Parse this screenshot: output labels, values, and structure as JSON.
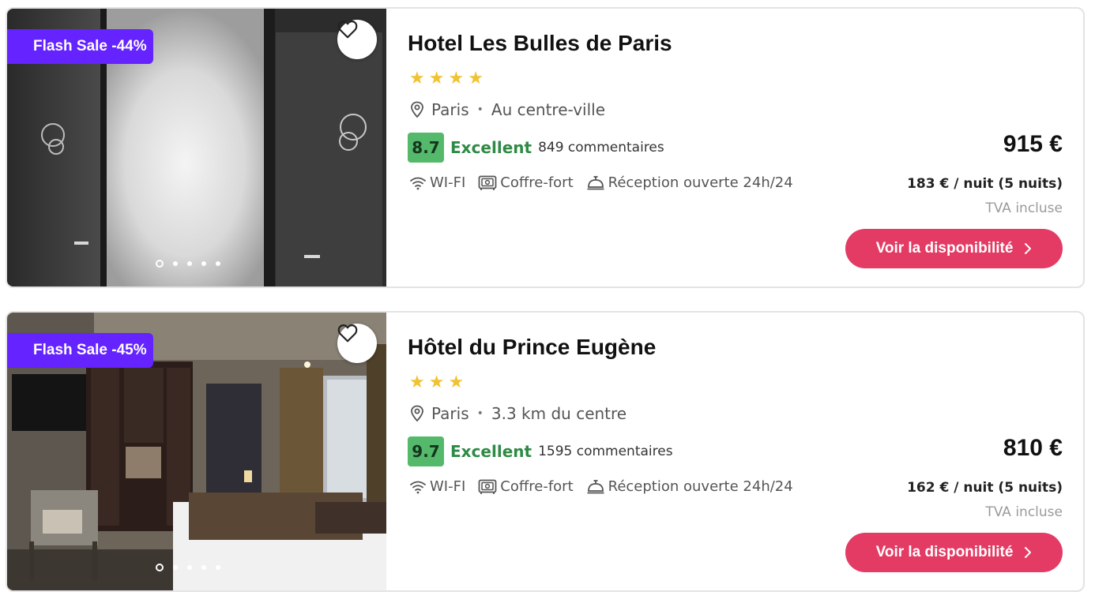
{
  "hotels": [
    {
      "badge": "Flash Sale -44%",
      "name": "Hotel Les Bulles de Paris",
      "stars": 4,
      "city": "Paris",
      "area": "Au centre-ville",
      "score": "8.7",
      "score_label": "Excellent",
      "reviews": "849 commentaires",
      "amenities": [
        "WI-FI",
        "Coffre-fort",
        "Réception ouverte 24h/24"
      ],
      "price": "915 €",
      "per_night": "183 € / nuit (5 nuits)",
      "vat": "TVA incluse",
      "cta": "Voir la disponibilité",
      "photo_dots": 5,
      "active_dot": 0
    },
    {
      "badge": "Flash Sale -45%",
      "name": "Hôtel du Prince Eugène",
      "stars": 3,
      "city": "Paris",
      "area": "3.3 km du centre",
      "score": "9.7",
      "score_label": "Excellent",
      "reviews": "1595 commentaires",
      "amenities": [
        "WI-FI",
        "Coffre-fort",
        "Réception ouverte 24h/24"
      ],
      "price": "810 €",
      "per_night": "162 € / nuit (5 nuits)",
      "vat": "TVA incluse",
      "cta": "Voir la disponibilité",
      "photo_dots": 5,
      "active_dot": 0
    }
  ],
  "icons": {
    "favorite": "heart-outline-icon",
    "location": "map-pin-icon",
    "wifi": "wifi-icon",
    "safe": "safe-icon",
    "reception": "reception-bell-icon",
    "cta_arrow": "chevron-right-icon"
  },
  "colors": {
    "badge": "#6423ff",
    "cta": "#e33b64",
    "score_bg": "#54b96b",
    "score_label": "#2f8a45",
    "star": "#f1c232"
  }
}
